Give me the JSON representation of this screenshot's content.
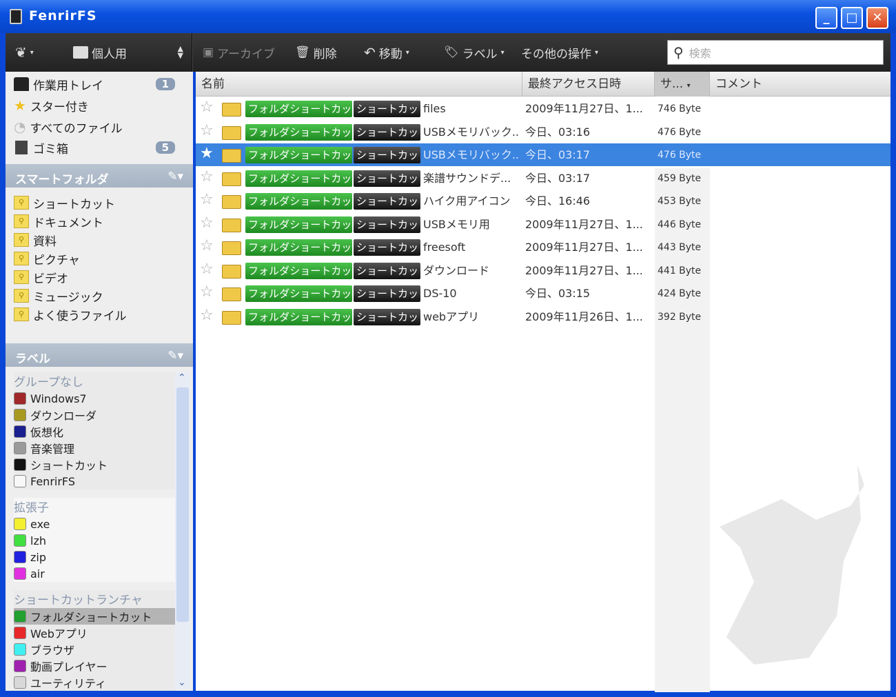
{
  "window": {
    "title": "FenrirFS",
    "minimize": "_",
    "maximize": "□",
    "close": "✕"
  },
  "toolbar": {
    "profile": "個人用",
    "archive": "アーカイブ",
    "delete": "削除",
    "move": "移動",
    "label": "ラベル",
    "more": "その他の操作",
    "search_placeholder": "検索"
  },
  "sidebar": {
    "items": [
      {
        "label": "作業用トレイ",
        "badge": "1"
      },
      {
        "label": "スター付き"
      },
      {
        "label": "すべてのファイル"
      },
      {
        "label": "ゴミ箱",
        "badge": "5"
      }
    ],
    "smart_header": "スマートフォルダ",
    "smart_folders": [
      "ショートカット",
      "ドキュメント",
      "資料",
      "ピクチャ",
      "ビデオ",
      "ミュージック",
      "よく使うファイル"
    ],
    "label_header": "ラベル",
    "label_groups": [
      {
        "title": "グループなし",
        "items": [
          {
            "label": "Windows7",
            "color": "#a02828"
          },
          {
            "label": "ダウンローダ",
            "color": "#a89a20"
          },
          {
            "label": "仮想化",
            "color": "#1a2090"
          },
          {
            "label": "音楽管理",
            "color": "#9a9a9a"
          },
          {
            "label": "ショートカット",
            "color": "#111111"
          },
          {
            "label": "FenrirFS",
            "color": "#f8f8f8"
          }
        ]
      },
      {
        "title": "拡張子",
        "items": [
          {
            "label": "exe",
            "color": "#f4f030"
          },
          {
            "label": "lzh",
            "color": "#40e040"
          },
          {
            "label": "zip",
            "color": "#2020e0"
          },
          {
            "label": "air",
            "color": "#e030e0"
          }
        ]
      },
      {
        "title": "ショートカットランチャ",
        "items": [
          {
            "label": "フォルダショートカット",
            "color": "#22a030"
          },
          {
            "label": "Webアプリ",
            "color": "#e82828"
          },
          {
            "label": "ブラウザ",
            "color": "#40f0f0"
          },
          {
            "label": "動画プレイヤー",
            "color": "#a020b0"
          },
          {
            "label": "ユーティリティ",
            "color": "#d8d8d8"
          }
        ]
      }
    ]
  },
  "list": {
    "columns": {
      "name": "名前",
      "date": "最終アクセス日時",
      "size": "サ...",
      "comment": "コメント"
    },
    "tag_green": "フォルダショートカット",
    "tag_black": "ショートカット",
    "rows": [
      {
        "name": "files",
        "date": "2009年11月27日、1...",
        "size": "746 Byte"
      },
      {
        "name": "USBメモリバック...",
        "date": "今日、03:16",
        "size": "476 Byte"
      },
      {
        "name": "USBメモリバック...",
        "date": "今日、03:17",
        "size": "476 Byte",
        "selected": true
      },
      {
        "name": "楽譜サウンドデ...",
        "date": "今日、03:17",
        "size": "459 Byte"
      },
      {
        "name": "ハイク用アイコン",
        "date": "今日、16:46",
        "size": "453 Byte"
      },
      {
        "name": "USBメモリ用",
        "date": "2009年11月27日、1...",
        "size": "446 Byte"
      },
      {
        "name": "freesoft",
        "date": "2009年11月27日、1...",
        "size": "443 Byte"
      },
      {
        "name": "ダウンロード",
        "date": "2009年11月27日、1...",
        "size": "441 Byte"
      },
      {
        "name": "DS-10",
        "date": "今日、03:15",
        "size": "424 Byte"
      },
      {
        "name": "webアプリ",
        "date": "2009年11月26日、1...",
        "size": "392 Byte"
      }
    ]
  }
}
